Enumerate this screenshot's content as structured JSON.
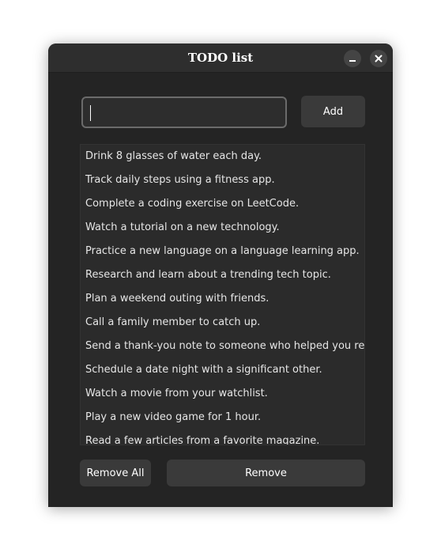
{
  "window": {
    "title": "TODO list",
    "minimize_icon": "minimize-icon",
    "close_icon": "close-icon"
  },
  "input": {
    "value": "",
    "placeholder": ""
  },
  "buttons": {
    "add": "Add",
    "remove_all": "Remove All",
    "remove": "Remove"
  },
  "todos": [
    "Drink 8 glasses of water each day.",
    "Track daily steps using a fitness app.",
    "Complete a coding exercise on LeetCode.",
    "Watch a tutorial on a new technology.",
    "Practice a new language on a language learning app.",
    "Research and learn about a trending tech topic.",
    "Plan a weekend outing with friends.",
    "Call a family member to catch up.",
    "Send a thank-you note to someone who helped you recent",
    "Schedule a date night with a significant other.",
    "Watch a movie from your watchlist.",
    "Play a new video game for 1 hour.",
    "Read a few articles from a favorite magazine."
  ],
  "colors": {
    "window_bg": "#242424",
    "titlebar_bg": "#2e2e2e",
    "button_bg": "#3a3a3a",
    "list_bg": "#2b2b2b",
    "text": "#e6e6e6"
  }
}
